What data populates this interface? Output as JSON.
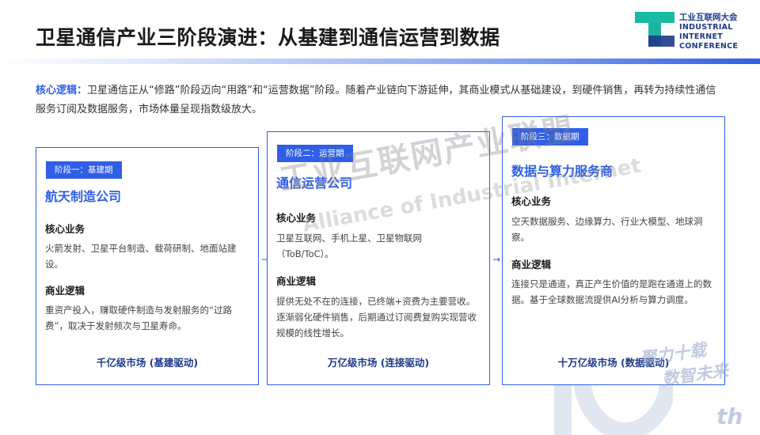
{
  "header": {
    "title": "卫星通信产业三阶段演进：从基建到通信运营到数据"
  },
  "logo": {
    "cn": "工业互联网大会",
    "en_line1": "INDUSTRIAL",
    "en_line2": "INTERNET",
    "en_line3": "CONFERENCE"
  },
  "core_logic": {
    "label": "核心逻辑：",
    "text": "卫星通信正从“修路”阶段迈向“用路”和“运营数据”阶段。随着产业链向下游延伸，其商业模式从基础建设，到硬件销售，再转为持续性通信服务订阅及数据服务，市场体量呈现指数级放大。"
  },
  "stages": [
    {
      "badge": "阶段一：基建期",
      "name": "航天制造公司",
      "section1": "核心业务",
      "text1": "火箭发射、卫星平台制造、载荷研制、地面站建设。",
      "section2": "商业逻辑",
      "text2": "重资产投入，赚取硬件制造与发射服务的“过路费”，取决于发射频次与卫星寿命。",
      "footer": "千亿级市场 (基建驱动)"
    },
    {
      "badge": "阶段二：运营期",
      "name": "通信运营公司",
      "section1": "核心业务",
      "text1": "卫星互联网、手机上星、卫星物联网（ToB/ToC）。",
      "section2": "商业逻辑",
      "text2": "提供无处不在的连接，已终端+资费为主要营收。逐渐弱化硬件销售，后期通过订阅费复购实现营收规模的线性增长。",
      "footer": "万亿级市场 (连接驱动)"
    },
    {
      "badge": "阶段三：数据期",
      "name": "数据与算力服务商",
      "section1": "核心业务",
      "text1": "空天数据服务、边缘算力、行业大模型、地球洞察。",
      "section2": "商业逻辑",
      "text2": "连接只是通道，真正产生价值的是跑在通道上的数据。基于全球数据流提供AI分析与算力调度。",
      "footer": "十万亿级市场 (数据驱动)"
    }
  ],
  "watermark": {
    "main": "工业互联网产业联盟",
    "sub": "Alliance of Industrial Internet",
    "slogan1": "聚力十载",
    "slogan2": "数智未来",
    "suffix": "th"
  },
  "arrow_glyph": "→",
  "colors": {
    "accent": "#2f5fe6",
    "dark_blue": "#1f3a8a",
    "logo_green": "#19b9a4"
  },
  "icons": [
    "gear-watermark-icon",
    "arrow-right-icon"
  ]
}
